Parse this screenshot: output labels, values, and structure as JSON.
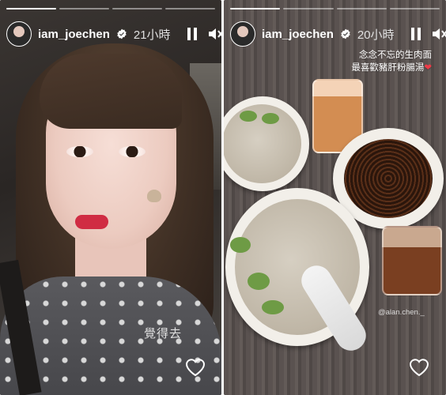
{
  "stories": [
    {
      "username": "iam_joechen",
      "time": "21小時",
      "sticker_text": "覺得去",
      "progress": [
        1,
        0,
        0,
        0
      ],
      "icons": [
        "verified-icon",
        "pause-icon",
        "mute-icon",
        "more-icon",
        "heart-icon"
      ]
    },
    {
      "username": "iam_joechen",
      "time": "20小時",
      "caption_line1": "念念不忘的生肉面",
      "caption_line2": "最喜歡豬肝粉腸湯",
      "caption_emoji": "❤",
      "mention": "@alan.chen._",
      "progress": [
        1,
        0,
        0,
        0
      ],
      "icons": [
        "verified-icon",
        "pause-icon",
        "mute-icon",
        "more-icon",
        "heart-icon"
      ]
    }
  ],
  "colors": {
    "verified": "#ffffff",
    "heart_emoji": "#ee3b48"
  }
}
